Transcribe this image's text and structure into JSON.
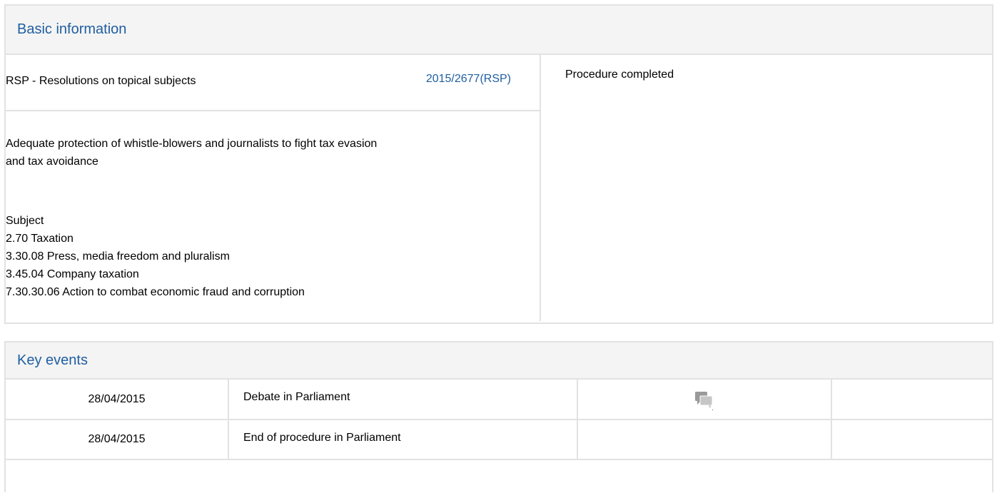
{
  "basic_info": {
    "header": "Basic information",
    "procedure_type": "RSP - Resolutions on topical subjects",
    "reference": "2015/2677(RSP)",
    "status": "Procedure completed",
    "title_lines": [
      "Adequate protection of whistle-blowers and journalists to fight tax evasion",
      "and tax avoidance"
    ],
    "subject_heading": "Subject",
    "subjects": [
      "2.70 Taxation",
      "3.30.08 Press, media freedom and pluralism",
      "3.45.04 Company taxation",
      "7.30.30.06 Action to combat economic fraud and corruption"
    ]
  },
  "key_events": {
    "header": "Key events",
    "rows": [
      {
        "date": "28/04/2015",
        "event": "Debate in Parliament",
        "icon": "debate-icon"
      },
      {
        "date": "28/04/2015",
        "event": "End of procedure in Parliament",
        "icon": ""
      }
    ]
  },
  "colors": {
    "header_text": "#1f5fa0",
    "border": "#e2e2e2",
    "header_bg": "#f4f4f4"
  }
}
